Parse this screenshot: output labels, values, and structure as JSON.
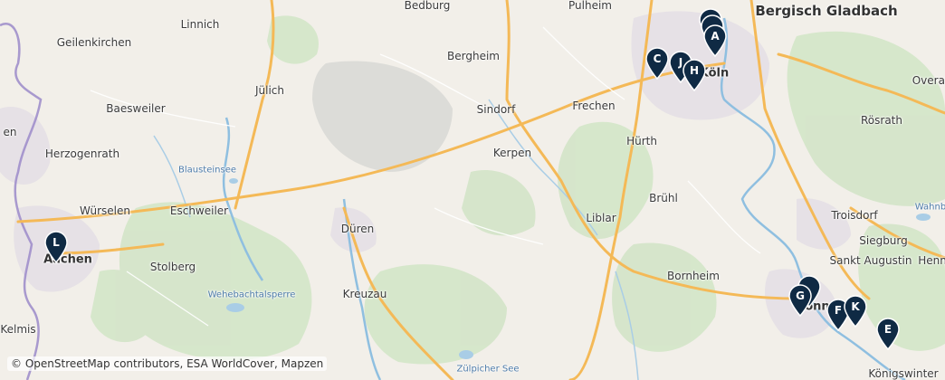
{
  "map": {
    "places": [
      {
        "id": "bergisch-gladbach",
        "label": "Bergisch Gladbach",
        "kind": "big"
      },
      {
        "id": "bedburg",
        "label": "Bedburg",
        "kind": "town"
      },
      {
        "id": "pulheim",
        "label": "Pulheim",
        "kind": "town"
      },
      {
        "id": "linnich",
        "label": "Linnich",
        "kind": "town"
      },
      {
        "id": "geilenkirchen",
        "label": "Geilenkirchen",
        "kind": "town"
      },
      {
        "id": "bergheim",
        "label": "Bergheim",
        "kind": "town"
      },
      {
        "id": "julich",
        "label": "Jülich",
        "kind": "town"
      },
      {
        "id": "sindorf",
        "label": "Sindorf",
        "kind": "town"
      },
      {
        "id": "frechen",
        "label": "Frechen",
        "kind": "town"
      },
      {
        "id": "koln",
        "label": "Köln",
        "kind": "city"
      },
      {
        "id": "baesweiler",
        "label": "Baesweiler",
        "kind": "town"
      },
      {
        "id": "rosrath",
        "label": "Rösrath",
        "kind": "town"
      },
      {
        "id": "overath",
        "label": "Overath",
        "kind": "town"
      },
      {
        "id": "herzogenrath",
        "label": "Herzogenrath",
        "kind": "town"
      },
      {
        "id": "hurth",
        "label": "Hürth",
        "kind": "town"
      },
      {
        "id": "kerpen",
        "label": "Kerpen",
        "kind": "town"
      },
      {
        "id": "blausteinsee",
        "label": "Blausteinsee",
        "kind": "feature"
      },
      {
        "id": "bruhl",
        "label": "Brühl",
        "kind": "town"
      },
      {
        "id": "wurselen",
        "label": "Würselen",
        "kind": "town"
      },
      {
        "id": "eschweiler",
        "label": "Eschweiler",
        "kind": "town"
      },
      {
        "id": "liblar",
        "label": "Liblar",
        "kind": "town"
      },
      {
        "id": "troisdorf",
        "label": "Troisdorf",
        "kind": "town"
      },
      {
        "id": "wahnbach",
        "label": "Wahnb",
        "kind": "feature"
      },
      {
        "id": "duren",
        "label": "Düren",
        "kind": "town"
      },
      {
        "id": "siegburg",
        "label": "Siegburg",
        "kind": "town"
      },
      {
        "id": "aachen",
        "label": "Aachen",
        "kind": "city"
      },
      {
        "id": "stolberg",
        "label": "Stolberg",
        "kind": "town"
      },
      {
        "id": "sankt-augustin",
        "label": "Sankt Augustin",
        "kind": "town"
      },
      {
        "id": "hennef",
        "label": "Henn",
        "kind": "town"
      },
      {
        "id": "bornheim",
        "label": "Bornheim",
        "kind": "town"
      },
      {
        "id": "wehebachtalsperre",
        "label": "Wehebachtalsperre",
        "kind": "feature"
      },
      {
        "id": "kreuzau",
        "label": "Kreuzau",
        "kind": "town"
      },
      {
        "id": "bonn",
        "label": "Bonn",
        "kind": "city"
      },
      {
        "id": "kelmis",
        "label": "Kelmis",
        "kind": "town"
      },
      {
        "id": "zulpicher-see",
        "label": "Zülpicher See",
        "kind": "feature"
      },
      {
        "id": "konigswinter",
        "label": "Königswinter",
        "kind": "town"
      },
      {
        "id": "partial-en",
        "label": "en",
        "kind": "town"
      }
    ],
    "markers": [
      "A",
      "C",
      "J",
      "H",
      "L",
      "G",
      "F",
      "K",
      "E"
    ],
    "attribution": "© OpenStreetMap contributors, ESA WorldCover, Mapzen",
    "colors": {
      "marker": "#0f2a44",
      "motorway": "#f3b54a",
      "river": "#8fbfe0",
      "forest": "#cfe3c4",
      "urban": "#e3dfe3",
      "border": "#9b89c9"
    }
  }
}
